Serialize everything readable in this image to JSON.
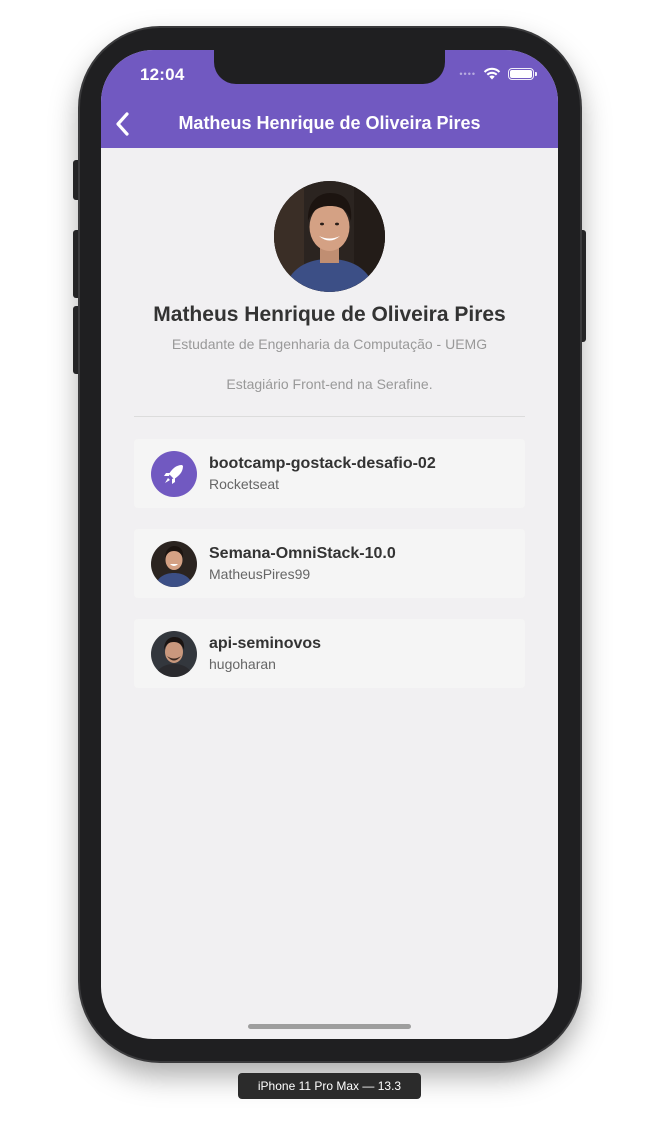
{
  "status_bar": {
    "time": "12:04",
    "signal": "••••"
  },
  "header": {
    "title": "Matheus Henrique de Oliveira Pires",
    "back_icon": "chevron-left-icon",
    "background_color": "#7159c1"
  },
  "profile": {
    "name": "Matheus Henrique de Oliveira Pires",
    "subtitle": "Estudante de Engenharia da Computação - UEMG",
    "bio": "Estagiário Front-end na Serafine."
  },
  "repositories": [
    {
      "title": "bootcamp-gostack-desafio-02",
      "owner": "Rocketseat",
      "avatar": "rocketseat-logo-icon"
    },
    {
      "title": "Semana-OmniStack-10.0",
      "owner": "MatheusPires99",
      "avatar": "avatar-photo"
    },
    {
      "title": "api-seminovos",
      "owner": "hugoharan",
      "avatar": "avatar-photo"
    }
  ],
  "simulator_label": "iPhone 11 Pro Max — 13.3",
  "colors": {
    "accent": "#7159c1",
    "background": "#f1f0f2",
    "card": "#f5f5f5",
    "title_text": "#333333",
    "muted_text": "#999999"
  }
}
